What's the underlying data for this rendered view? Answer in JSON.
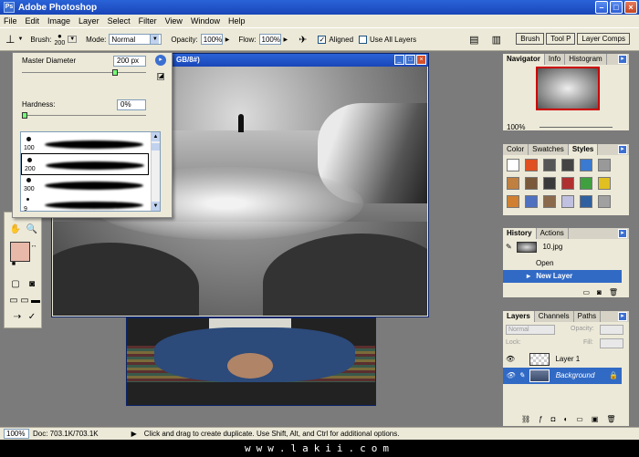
{
  "app": {
    "title": "Adobe Photoshop"
  },
  "menu": [
    "File",
    "Edit",
    "Image",
    "Layer",
    "Select",
    "Filter",
    "View",
    "Window",
    "Help"
  ],
  "options": {
    "brush_label": "Brush:",
    "brush_size": "200",
    "mode_label": "Mode:",
    "mode_value": "Normal",
    "opacity_label": "Opacity:",
    "opacity_value": "100%",
    "flow_label": "Flow:",
    "flow_value": "100%",
    "aligned_label": "Aligned",
    "aligned_checked": "✓",
    "use_all_layers_label": "Use All Layers",
    "wells": [
      "Brush",
      "Tool P",
      "Layer Comps"
    ]
  },
  "brush_popup": {
    "master_diameter_label": "Master Diameter",
    "master_diameter_value": "200 px",
    "master_diameter_level": 0.75,
    "hardness_label": "Hardness:",
    "hardness_value": "0%",
    "hardness_level": 0.0,
    "presets": [
      {
        "size": "100"
      },
      {
        "size": "200"
      },
      {
        "size": "300"
      },
      {
        "size": "9"
      }
    ]
  },
  "document": {
    "title_fragment": "GB/8#)"
  },
  "navigator": {
    "tabs": [
      "Navigator",
      "Info",
      "Histogram"
    ],
    "zoom": "100%"
  },
  "color_panel": {
    "tabs": [
      "Color",
      "Swatches",
      "Styles"
    ]
  },
  "styles_colors": [
    "#ffffff",
    "#e05020",
    "#555555",
    "#444444",
    "#3a7ad0",
    "#999999",
    "#c08040",
    "#7a5a3a",
    "#3a3a3a",
    "#b03030",
    "#40a040",
    "#e0c020",
    "#d08030",
    "#5070c0",
    "#8a6a4a",
    "#c0c0e0",
    "#3060a0",
    "#a0a0a0"
  ],
  "history": {
    "tabs": [
      "History",
      "Actions"
    ],
    "snapshot": "10.jpg",
    "items": [
      "Open",
      "New Layer"
    ]
  },
  "layers": {
    "tabs": [
      "Layers",
      "Channels",
      "Paths"
    ],
    "blend_mode": "Normal",
    "opacity_label": "Opacity:",
    "lock_label": "Lock:",
    "fill_label": "Fill:",
    "rows": [
      "Layer 1",
      "Background"
    ]
  },
  "status": {
    "zoom": "100%",
    "doc_size": "Doc: 703.1K/703.1K",
    "hint": "Click and drag to create duplicate.  Use Shift, Alt, and Ctrl for additional options."
  },
  "watermark": "www.lakii.com"
}
